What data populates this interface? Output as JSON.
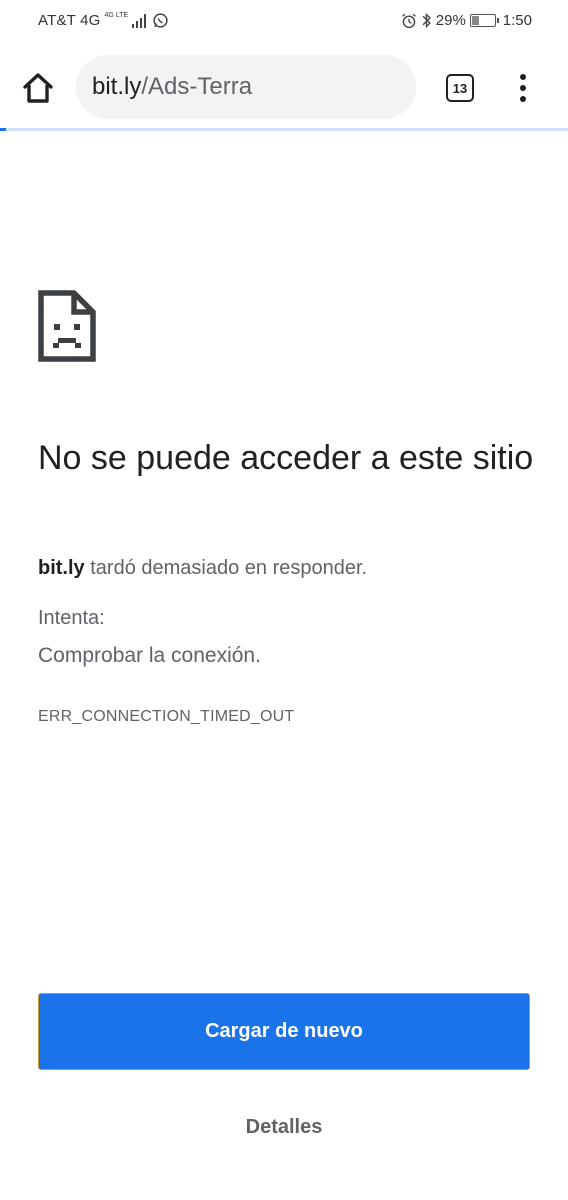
{
  "status_bar": {
    "carrier": "AT&T 4G",
    "net_tiny": "4G LTE",
    "battery_percent": "29%",
    "battery_level": 0.29,
    "time": "1:50",
    "icons": [
      "whatsapp-icon",
      "alarm-icon",
      "bluetooth-icon",
      "battery-icon",
      "signal-icon"
    ]
  },
  "toolbar": {
    "url_host": "bit.ly",
    "url_path": "/Ads-Terra",
    "tab_count": "13",
    "icons": [
      "home-icon",
      "tab-switcher-icon",
      "overflow-menu-icon"
    ]
  },
  "page_load_progress": 0.01,
  "error_page": {
    "icon": "sad-page-icon",
    "title": "No se puede acceder a este sitio",
    "host": "bit.ly",
    "desc_rest": " tardó demasiado en responder.",
    "suggest_heading": "Intenta:",
    "suggest_item": "Comprobar la conexión.",
    "error_code": "ERR_CONNECTION_TIMED_OUT",
    "reload_label": "Cargar de nuevo",
    "details_label": "Detalles"
  },
  "colors": {
    "accent": "#1a73e8",
    "text_primary": "#202124",
    "text_secondary": "#5f6368",
    "url_bar_bg": "#f1f3f4"
  }
}
